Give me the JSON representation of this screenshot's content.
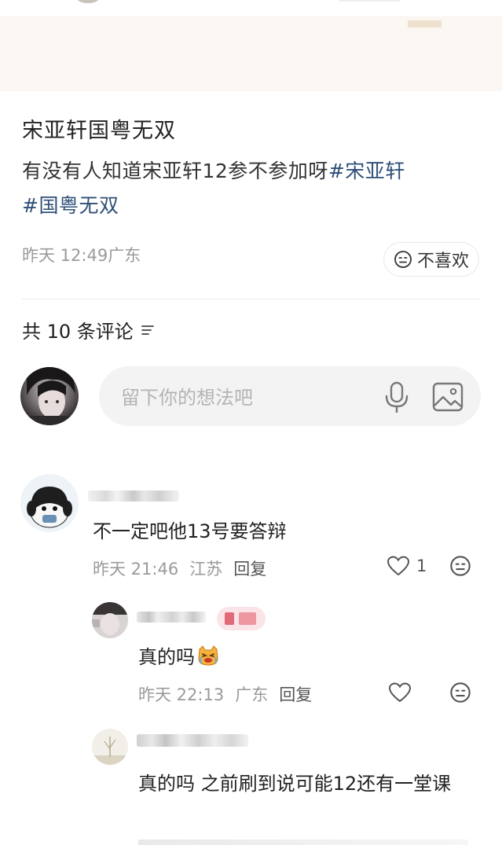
{
  "post": {
    "title": "宋亚轩国粤无双",
    "body_text": "有没有人知道宋亚轩12参不参加呀",
    "tag1": "#宋亚轩",
    "tag2": "#国粤无双",
    "meta": "昨天 12:49广东",
    "dislike_label": "不喜欢"
  },
  "comments_header": {
    "count_label": "共 10 条评论"
  },
  "composer": {
    "placeholder": "留下你的想法吧"
  },
  "comments": [
    {
      "text": "不一定吧他13号要答辩",
      "time": "昨天 21:46",
      "location": "江苏",
      "reply_label": "回复",
      "likes": "1"
    },
    {
      "text": "真的吗",
      "time": "昨天 22:13",
      "location": "广东",
      "reply_label": "回复"
    },
    {
      "text": "真的吗 之前刷到说可能12还有一堂课"
    }
  ],
  "icons": {
    "sort": "sort-lines-icon",
    "mic": "microphone-icon",
    "image": "image-icon",
    "like": "heart-icon",
    "dislike": "meh-face-icon",
    "emoji": "cat-crying-emoji"
  },
  "colors": {
    "tag": "#2f4f77",
    "meta": "#9a9a9a",
    "input_bg": "#f3f3f3"
  }
}
